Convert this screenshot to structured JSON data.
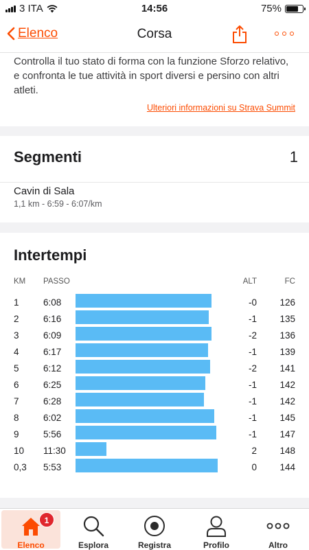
{
  "status": {
    "carrier": "3 ITA",
    "time": "14:56",
    "battery_percent": "75%",
    "battery_level": 0.75
  },
  "nav": {
    "back_label": "Elenco",
    "title": "Corsa"
  },
  "summit": {
    "description": "Controlla il tuo stato di forma con la funzione Sforzo relativo, e confronta le tue attività in sport diversi e persino con altri atleti.",
    "link": "Ulteriori informazioni su Strava Summit"
  },
  "segments": {
    "title": "Segmenti",
    "count": "1",
    "items": [
      {
        "name": "Cavin di Sala",
        "meta": "1,1 km - 6:59 - 6:07/km"
      }
    ]
  },
  "splits": {
    "title": "Intertempi",
    "headers": {
      "km": "KM",
      "pace": "PASSO",
      "alt": "ALT",
      "hr": "FC"
    },
    "rows": [
      {
        "km": "1",
        "pace": "6:08",
        "alt": "-0",
        "hr": "126"
      },
      {
        "km": "2",
        "pace": "6:16",
        "alt": "-1",
        "hr": "135"
      },
      {
        "km": "3",
        "pace": "6:09",
        "alt": "-2",
        "hr": "136"
      },
      {
        "km": "4",
        "pace": "6:17",
        "alt": "-1",
        "hr": "139"
      },
      {
        "km": "5",
        "pace": "6:12",
        "alt": "-2",
        "hr": "141"
      },
      {
        "km": "6",
        "pace": "6:25",
        "alt": "-1",
        "hr": "142"
      },
      {
        "km": "7",
        "pace": "6:28",
        "alt": "-1",
        "hr": "142"
      },
      {
        "km": "8",
        "pace": "6:02",
        "alt": "-1",
        "hr": "145"
      },
      {
        "km": "9",
        "pace": "5:56",
        "alt": "-1",
        "hr": "147"
      },
      {
        "km": "10",
        "pace": "11:30",
        "alt": "2",
        "hr": "148"
      },
      {
        "km": "0,3",
        "pace": "5:53",
        "alt": "0",
        "hr": "144"
      }
    ],
    "bar_color": "#5abbf5"
  },
  "tabs": [
    {
      "label": "Elenco",
      "icon": "home-icon",
      "active": true,
      "badge": "1"
    },
    {
      "label": "Esplora",
      "icon": "search-icon"
    },
    {
      "label": "Registra",
      "icon": "record-icon"
    },
    {
      "label": "Profilo",
      "icon": "profile-icon"
    },
    {
      "label": "Altro",
      "icon": "more-icon"
    }
  ],
  "colors": {
    "accent": "#fc4c02",
    "badge": "#e0262d"
  }
}
